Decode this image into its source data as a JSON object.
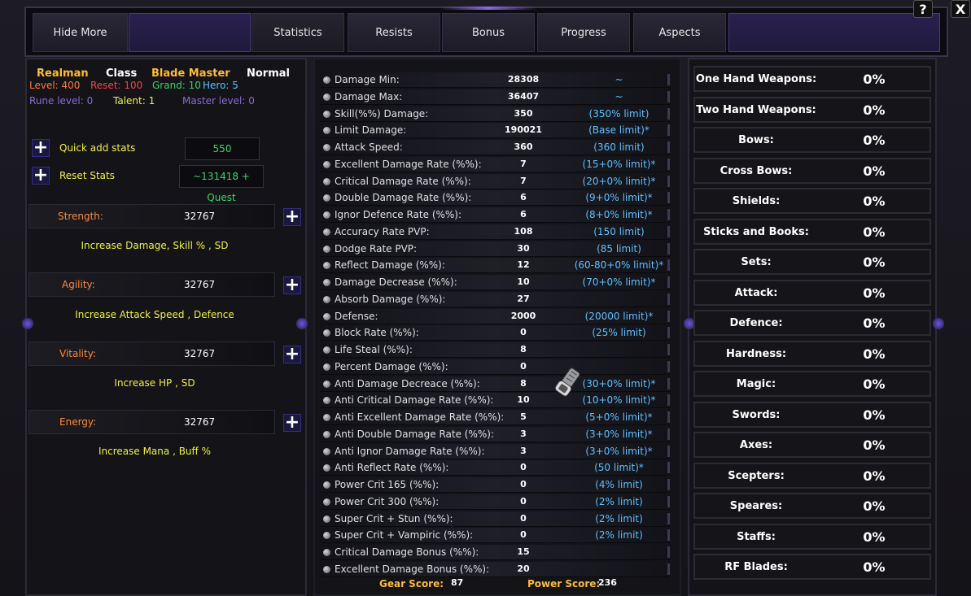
{
  "tabs": [
    {
      "label": "Hide More"
    },
    {
      "label": "Statistics"
    },
    {
      "label": "Resists"
    },
    {
      "label": "Bonus"
    },
    {
      "label": "Progress"
    },
    {
      "label": "Aspects"
    }
  ],
  "corner": {
    "help": "?",
    "close": "X"
  },
  "character": {
    "name": "Realman",
    "class_label": "Class",
    "class_name": "Blade Master",
    "mode": "Normal",
    "level": "Level: 400",
    "reset": "Reset: 100",
    "grand": "Grand: 10",
    "hero": "Hero: 5",
    "rune": "Rune level: 0",
    "talent": "Talent: 1",
    "master": "Master level: 0"
  },
  "quick_add": {
    "label": "Quick add stats",
    "value": "550"
  },
  "reset_stats": {
    "label": "Reset Stats",
    "value": "~131418 + Quest"
  },
  "stats": [
    {
      "label": "Strength:",
      "value": "32767",
      "desc": "Increase Damage, Skill % , SD"
    },
    {
      "label": "Agility:",
      "value": "32767",
      "desc": "Increase Attack Speed , Defence"
    },
    {
      "label": "Vitality:",
      "value": "32767",
      "desc": "Increase HP , SD"
    },
    {
      "label": "Energy:",
      "value": "32767",
      "desc": "Increase Mana , Buff %"
    }
  ],
  "details": [
    {
      "label": "Damage Min:",
      "value": "28308",
      "limit": "~"
    },
    {
      "label": "Damage Max:",
      "value": "36407",
      "limit": "~"
    },
    {
      "label": "Skill(%%) Damage:",
      "value": "350",
      "limit": "(350% limit)"
    },
    {
      "label": "Limit Damage:",
      "value": "190021",
      "limit": "(Base limit)*"
    },
    {
      "label": "Attack Speed:",
      "value": "360",
      "limit": "(360 limit)"
    },
    {
      "label": "Excellent Damage Rate (%%):",
      "value": "7",
      "limit": "(15+0% limit)*"
    },
    {
      "label": "Critical Damage Rate (%%):",
      "value": "7",
      "limit": "(20+0% limit)*"
    },
    {
      "label": "Double Damage Rate (%%):",
      "value": "6",
      "limit": "(9+0% limit)*"
    },
    {
      "label": "Ignor Defence Rate (%%):",
      "value": "6",
      "limit": "(8+0% limit)*"
    },
    {
      "label": "Accuracy Rate PVP:",
      "value": "108",
      "limit": "(150 limit)"
    },
    {
      "label": "Dodge Rate PVP:",
      "value": "30",
      "limit": "(85 limit)"
    },
    {
      "label": "Reflect Damage (%%):",
      "value": "12",
      "limit": "(60-80+0% limit)*"
    },
    {
      "label": "Damage Decrease (%%):",
      "value": "10",
      "limit": "(70+0% limit)*"
    },
    {
      "label": "Absorb Damage (%%):",
      "value": "27",
      "limit": ""
    },
    {
      "label": "Defense:",
      "value": "2000",
      "limit": "(20000 limit)*"
    },
    {
      "label": "Block Rate (%%):",
      "value": "0",
      "limit": "(25% limit)"
    },
    {
      "label": "Life Steal (%%):",
      "value": "8",
      "limit": ""
    },
    {
      "label": "Percent Damage (%%):",
      "value": "0",
      "limit": ""
    },
    {
      "label": "Anti Damage Decreace (%%):",
      "value": "8",
      "limit": "(30+0% limit)*"
    },
    {
      "label": "Anti Critical Damage Rate (%%):",
      "value": "10",
      "limit": "(10+0% limit)*"
    },
    {
      "label": "Anti Excellent Damage Rate (%%):",
      "value": "5",
      "limit": "(5+0% limit)*"
    },
    {
      "label": "Anti Double Damage Rate (%%):",
      "value": "3",
      "limit": "(3+0% limit)*"
    },
    {
      "label": "Anti Ignor Damage Rate (%%):",
      "value": "3",
      "limit": "(3+0% limit)*"
    },
    {
      "label": "Anti Reflect Rate (%%):",
      "value": "0",
      "limit": "(50 limit)*"
    },
    {
      "label": "Power Crit 165 (%%):",
      "value": "0",
      "limit": "(4% limit)"
    },
    {
      "label": "Power Crit 300 (%%):",
      "value": "0",
      "limit": "(2% limit)"
    },
    {
      "label": "Super Crit + Stun (%%):",
      "value": "0",
      "limit": "(2% limit)"
    },
    {
      "label": "Super Crit + Vampiric (%%):",
      "value": "0",
      "limit": "(2% limit)"
    },
    {
      "label": "Critical Damage Bonus (%%):",
      "value": "15",
      "limit": ""
    },
    {
      "label": "Excellent Damage Bonus (%%):",
      "value": "20",
      "limit": ""
    }
  ],
  "footer": {
    "gear_label": "Gear Score:",
    "gear_value": "87",
    "power_label": "Power Score:",
    "power_value": "236"
  },
  "weapons": [
    {
      "label": "One Hand Weapons:",
      "value": "0%"
    },
    {
      "label": "Two Hand Weapons:",
      "value": "0%"
    },
    {
      "label": "Bows:",
      "value": "0%"
    },
    {
      "label": "Cross Bows:",
      "value": "0%"
    },
    {
      "label": "Shields:",
      "value": "0%"
    },
    {
      "label": "Sticks and Books:",
      "value": "0%"
    },
    {
      "label": "Sets:",
      "value": "0%"
    },
    {
      "label": "Attack:",
      "value": "0%"
    },
    {
      "label": "Defence:",
      "value": "0%"
    },
    {
      "label": "Hardness:",
      "value": "0%"
    },
    {
      "label": "Magic:",
      "value": "0%"
    },
    {
      "label": "Swords:",
      "value": "0%"
    },
    {
      "label": "Axes:",
      "value": "0%"
    },
    {
      "label": "Scepters:",
      "value": "0%"
    },
    {
      "label": "Speares:",
      "value": "0%"
    },
    {
      "label": "Staffs:",
      "value": "0%"
    },
    {
      "label": "RF Blades:",
      "value": "0%"
    }
  ],
  "colors": {
    "limit": "#5ec0ff",
    "stat_label": "#ff8a3a",
    "desc": "#f0f040",
    "score": "#ffbb33",
    "name": "#ffbb33"
  }
}
